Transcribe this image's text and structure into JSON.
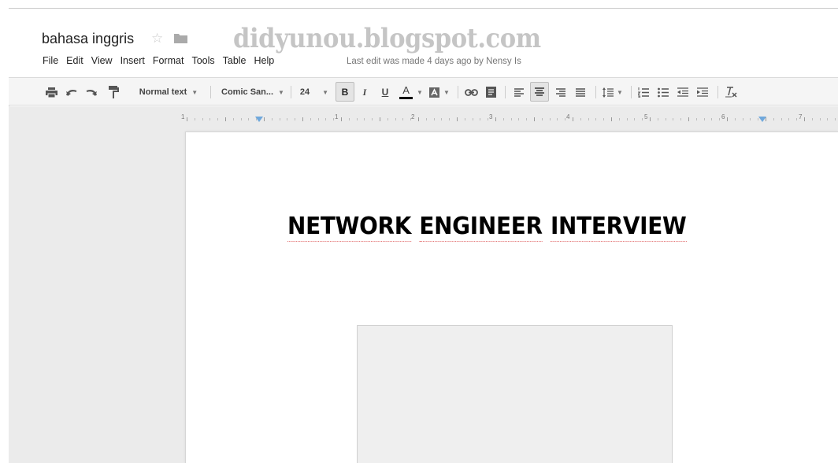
{
  "document": {
    "title": "bahasa inggris",
    "watermark": "didyunou.blogspot.com",
    "last_edit": "Last edit was made 4 days ago by Nensy Is"
  },
  "menu": [
    "File",
    "Edit",
    "View",
    "Insert",
    "Format",
    "Tools",
    "Table",
    "Help"
  ],
  "toolbar": {
    "style": "Normal text",
    "font": "Comic San...",
    "size": "24",
    "bold_label": "B",
    "italic_label": "I",
    "underline_label": "U",
    "text_color_label": "A",
    "clear_format_label": "Ix",
    "icons": [
      "print-icon",
      "undo-icon",
      "redo-icon",
      "paint-format-icon",
      "link-icon",
      "comment-icon",
      "align-left-icon",
      "align-center-icon",
      "align-right-icon",
      "justify-icon",
      "line-spacing-icon",
      "numbered-list-icon",
      "bulleted-list-icon",
      "decrease-indent-icon",
      "increase-indent-icon"
    ]
  },
  "ruler": {
    "labels": [
      "1",
      "1",
      "2",
      "3",
      "4",
      "5",
      "6",
      "7"
    ]
  },
  "page": {
    "heading_words": [
      "NETWORK",
      "ENGINEER",
      "INTERVIEW"
    ]
  },
  "colors": {
    "toolbar_bg": "#f5f5f5",
    "canvas_bg": "#ebebeb",
    "ruler_marker": "#6fa8dc",
    "spellcheck_underline": "#e06666",
    "text_color_bar": "#000000"
  }
}
